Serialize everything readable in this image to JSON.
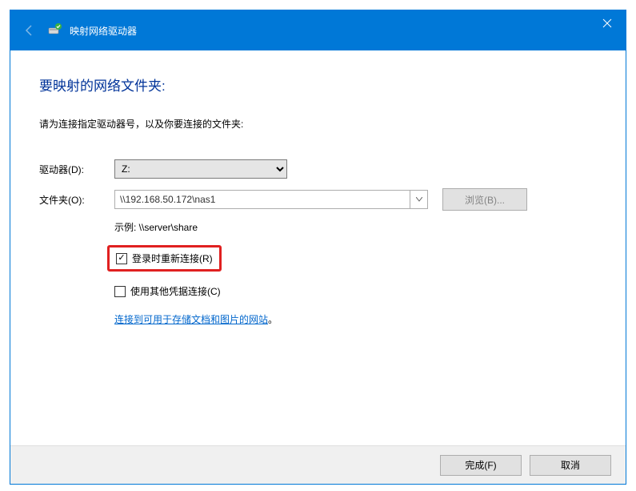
{
  "window": {
    "title": "映射网络驱动器"
  },
  "heading": "要映射的网络文件夹:",
  "instruction": "请为连接指定驱动器号，以及你要连接的文件夹:",
  "labels": {
    "drive": "驱动器(D):",
    "folder": "文件夹(O):"
  },
  "drive": {
    "value": "Z:"
  },
  "folder": {
    "value": "\\\\192.168.50.172\\nas1"
  },
  "browse": "浏览(B)...",
  "example": "示例: \\\\server\\share",
  "checkbox_reconnect": {
    "checked": true,
    "label": "登录时重新连接(R)"
  },
  "checkbox_other_creds": {
    "checked": false,
    "label": "使用其他凭据连接(C)"
  },
  "link": "连接到可用于存储文档和图片的网站",
  "link_suffix": "。",
  "footer": {
    "finish": "完成(F)",
    "cancel": "取消"
  }
}
